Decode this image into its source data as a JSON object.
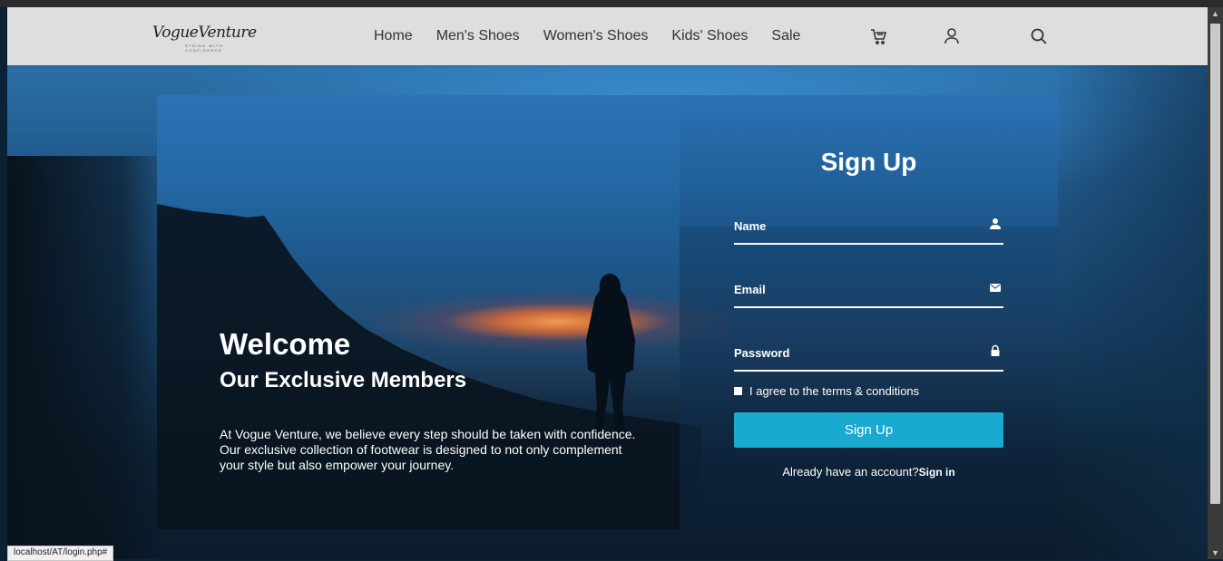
{
  "brand": {
    "logo_script": "VogueVenture",
    "logo_tagline": "STRIDE WITH CONFIDENCE"
  },
  "nav": {
    "links": [
      "Home",
      "Men's Shoes",
      "Women's Shoes",
      "Kids' Shoes",
      "Sale"
    ],
    "icons": [
      "cart-icon",
      "user-icon",
      "search-icon"
    ]
  },
  "hero": {
    "welcome": "Welcome",
    "subtitle": "Our Exclusive Members",
    "blurb": "At Vogue Venture, we believe every step should be taken with confidence. Our exclusive collection of footwear is designed to not only complement your style but also empower your journey."
  },
  "form": {
    "title": "Sign Up",
    "name_placeholder": "Name",
    "email_placeholder": "Email",
    "password_placeholder": "Password",
    "terms_label": "I agree to the terms & conditions",
    "submit_label": "Sign Up",
    "already_text": "Already have an account?",
    "signin_label": "Sign in"
  },
  "status_url": "localhost/AT/login.php#",
  "colors": {
    "accent": "#1aa9cf",
    "navbar_bg": "#dedede",
    "text_light": "#ffffff"
  }
}
